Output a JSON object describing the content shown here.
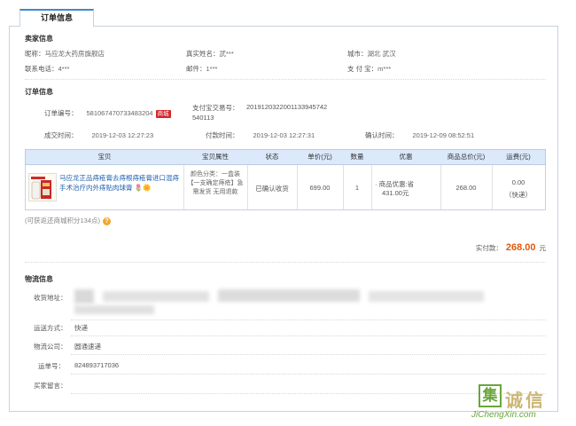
{
  "tab": {
    "label": "订单信息"
  },
  "seller": {
    "title": "卖家信息",
    "nickname_label": "昵称：",
    "nickname": "马应龙大药房旗舰店",
    "realname_label": "真实姓名：",
    "realname": "武***",
    "city_label": "城市：",
    "city": "湖北 武汉",
    "phone_label": "联系电话：",
    "phone": "4***",
    "email_label": "邮件：",
    "email": "1***",
    "alipay_label": "支 付 宝：",
    "alipay": "m***"
  },
  "order": {
    "title": "订单信息",
    "order_no_label": "订单编号：",
    "order_no": "581067470733483204",
    "badge": "商城",
    "pay_no_label": "支付宝交易号：",
    "pay_no_line1": "201912032200113394574​2",
    "pay_no_line2": "540113",
    "created_label": "成交时间：",
    "created": "2019-12-03 12:27:23",
    "paid_label": "付款时间：",
    "paid": "2019-12-03 12:27:31",
    "confirmed_label": "确认时间：",
    "confirmed": "2019-12-09 08:52:51"
  },
  "table": {
    "headers": [
      "宝贝",
      "宝贝属性",
      "状态",
      "单价(元)",
      "数量",
      "优惠",
      "商品总价(元)",
      "运费(元)"
    ],
    "row": {
      "product_title": "马应龙正品痔疮膏去痔根痔疮膏进口混痔手术治疗内外痔贴肉球膏",
      "attributes": "颜色分类：一盒装【一支确定痔疮】急需发货 无用退款",
      "status": "已确认收货",
      "unit_price": "699.00",
      "quantity": "1",
      "discount_line1": "· 商品优惠:省",
      "discount_line2": "431.00元",
      "total": "268.00",
      "shipping_fee": "0.00",
      "shipping_method": "（快递）"
    }
  },
  "credit_note": "(可获返还商城积分134点)",
  "payment": {
    "label": "实付款：",
    "amount": "268.00",
    "unit": "元"
  },
  "logistics": {
    "title": "物流信息",
    "address_label": "收货地址：",
    "ship_method_label": "运送方式：",
    "ship_method": "快递",
    "company_label": "物流公司：",
    "company": "圆通速递",
    "tracking_label": "运单号：",
    "tracking": "824893717036",
    "message_label": "买家留言："
  },
  "watermark": {
    "mark": "集",
    "brand": "诚信",
    "url": "JiChengXin.com"
  },
  "colors": {
    "accent": "#3c89d0",
    "price": "#e05a0b",
    "badge": "#d6262a",
    "header_bg": "#dbe9fb",
    "watermark": "#6aa63a"
  }
}
